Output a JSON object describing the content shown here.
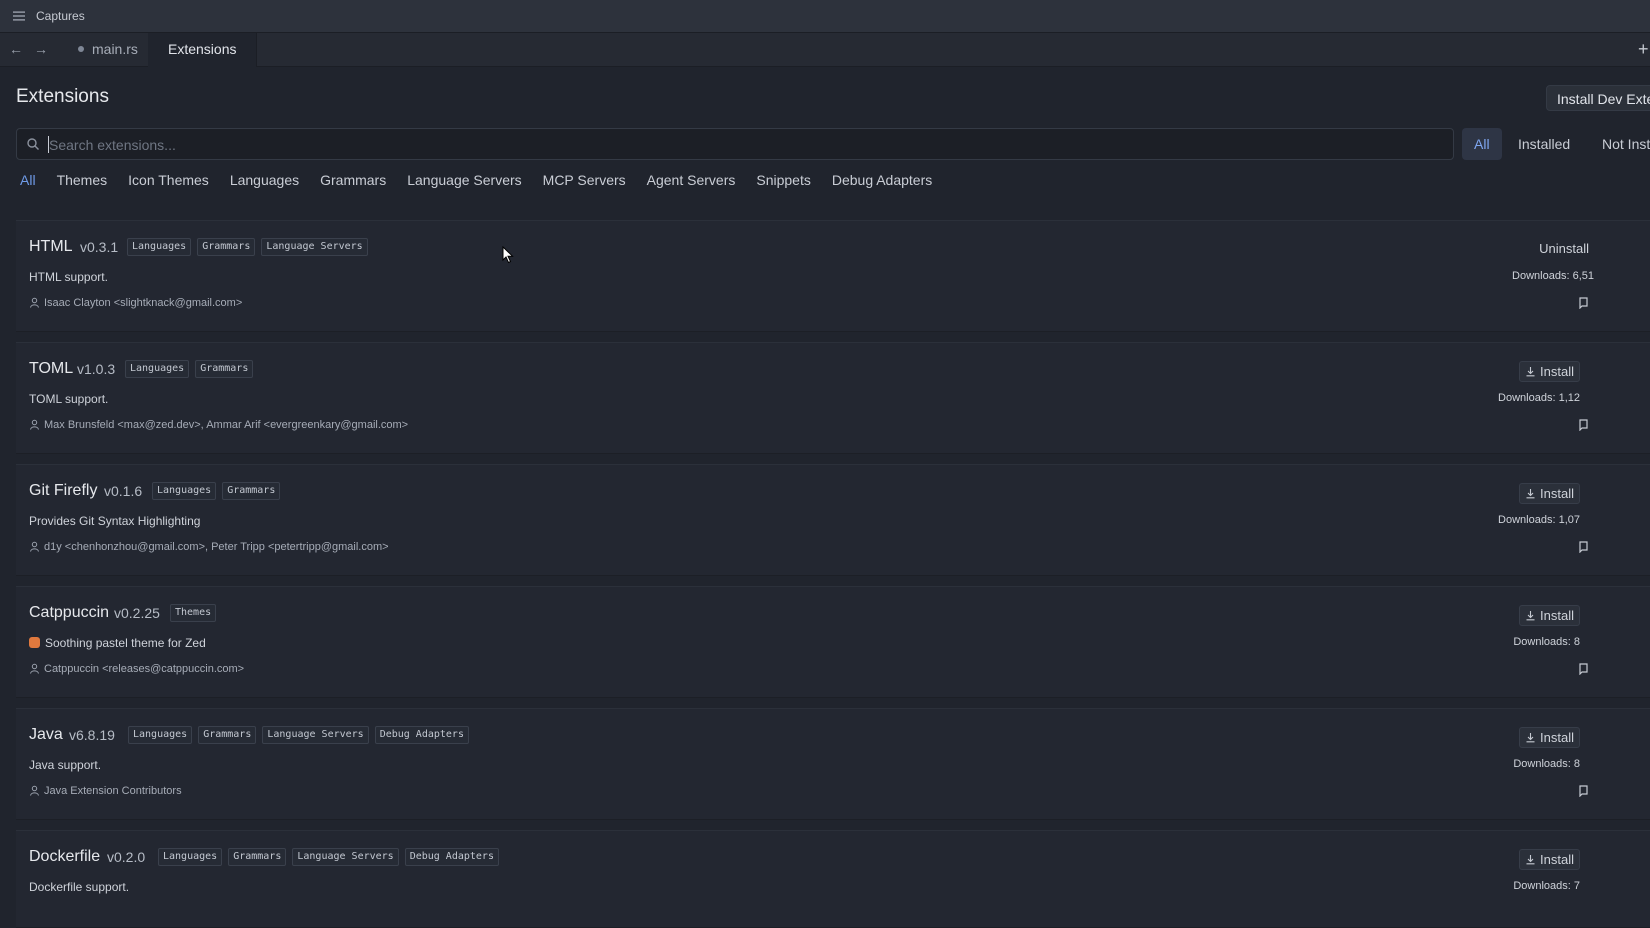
{
  "titlebar": {
    "app_title": "Captures",
    "menu_icon": "hamburger-menu-icon"
  },
  "tabs": [
    {
      "label": "main.rs",
      "dirty": true
    },
    {
      "label": "Extensions",
      "active": true
    }
  ],
  "header": {
    "title": "Extensions",
    "install_dev_label": "Install Dev Extension"
  },
  "search": {
    "placeholder": "Search extensions...",
    "value": ""
  },
  "filters": [
    "All",
    "Installed",
    "Not Installed"
  ],
  "categories": [
    "All",
    "Themes",
    "Icon Themes",
    "Languages",
    "Grammars",
    "Language Servers",
    "MCP Servers",
    "Agent Servers",
    "Snippets",
    "Debug Adapters"
  ],
  "extensions": [
    {
      "name": "HTML",
      "version": "v0.3.1",
      "tags": [
        "Languages",
        "Grammars",
        "Language Servers"
      ],
      "description": "HTML support.",
      "authors": "Isaac Clayton <slightknack@gmail.com>",
      "action": "Uninstall",
      "downloads": "Downloads: 6,51"
    },
    {
      "name": "TOML",
      "version": "v1.0.3",
      "tags": [
        "Languages",
        "Grammars"
      ],
      "description": "TOML support.",
      "authors": "Max Brunsfeld <max@zed.dev>, Ammar Arif <evergreenkary@gmail.com>",
      "action": "Install",
      "downloads": "Downloads: 1,12"
    },
    {
      "name": "Git Firefly",
      "version": "v0.1.6",
      "tags": [
        "Languages",
        "Grammars"
      ],
      "description": "Provides Git Syntax Highlighting",
      "authors": "d1y <chenhonzhou@gmail.com>, Peter Tripp <petertripp@gmail.com>",
      "action": "Install",
      "downloads": "Downloads: 1,07"
    },
    {
      "name": "Catppuccin",
      "version": "v0.2.25",
      "tags": [
        "Themes"
      ],
      "description": "Soothing pastel theme for Zed",
      "authors": "Catppuccin <releases@catppuccin.com>",
      "action": "Install",
      "downloads": "Downloads: 8"
    },
    {
      "name": "Java",
      "version": "v6.8.19",
      "tags": [
        "Languages",
        "Grammars",
        "Language Servers",
        "Debug Adapters"
      ],
      "description": "Java support.",
      "authors": "Java Extension Contributors",
      "action": "Install",
      "downloads": "Downloads: 8"
    },
    {
      "name": "Dockerfile",
      "version": "v0.2.0",
      "tags": [
        "Languages",
        "Grammars",
        "Language Servers",
        "Debug Adapters"
      ],
      "description": "Dockerfile support.",
      "authors": "",
      "action": "Install",
      "downloads": "Downloads: 7"
    }
  ],
  "colors": {
    "background": "#20242d",
    "accent": "#6f9be8",
    "card": "#232731"
  }
}
